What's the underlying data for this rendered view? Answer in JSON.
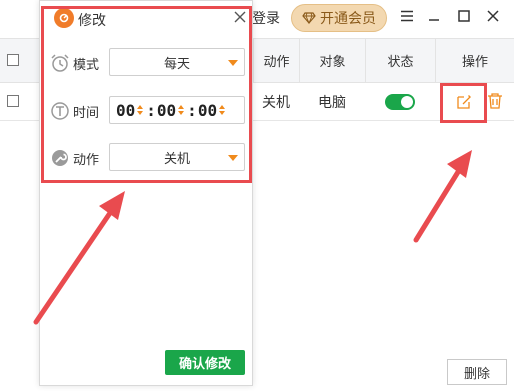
{
  "header": {
    "login_label": "登录",
    "vip_label": "开通会员"
  },
  "table": {
    "headers": {
      "action": "动作",
      "target": "对象",
      "status": "状态",
      "operation": "操作"
    },
    "row": {
      "action": "关机",
      "target": "电脑",
      "status_on": true
    }
  },
  "footer": {
    "delete_label": "删除"
  },
  "dialog": {
    "title": "修改",
    "mode_label": "模式",
    "mode_value": "每天",
    "time_label": "时间",
    "time": {
      "hh": "00",
      "mm": "00",
      "ss": "00"
    },
    "action_label": "动作",
    "action_value": "关机",
    "confirm_label": "确认修改"
  },
  "colors": {
    "accent_green": "#1aa64a",
    "accent_orange": "#f08a1c",
    "highlight_red": "#e94b4f",
    "vip_gold": "#f3d8b0"
  }
}
